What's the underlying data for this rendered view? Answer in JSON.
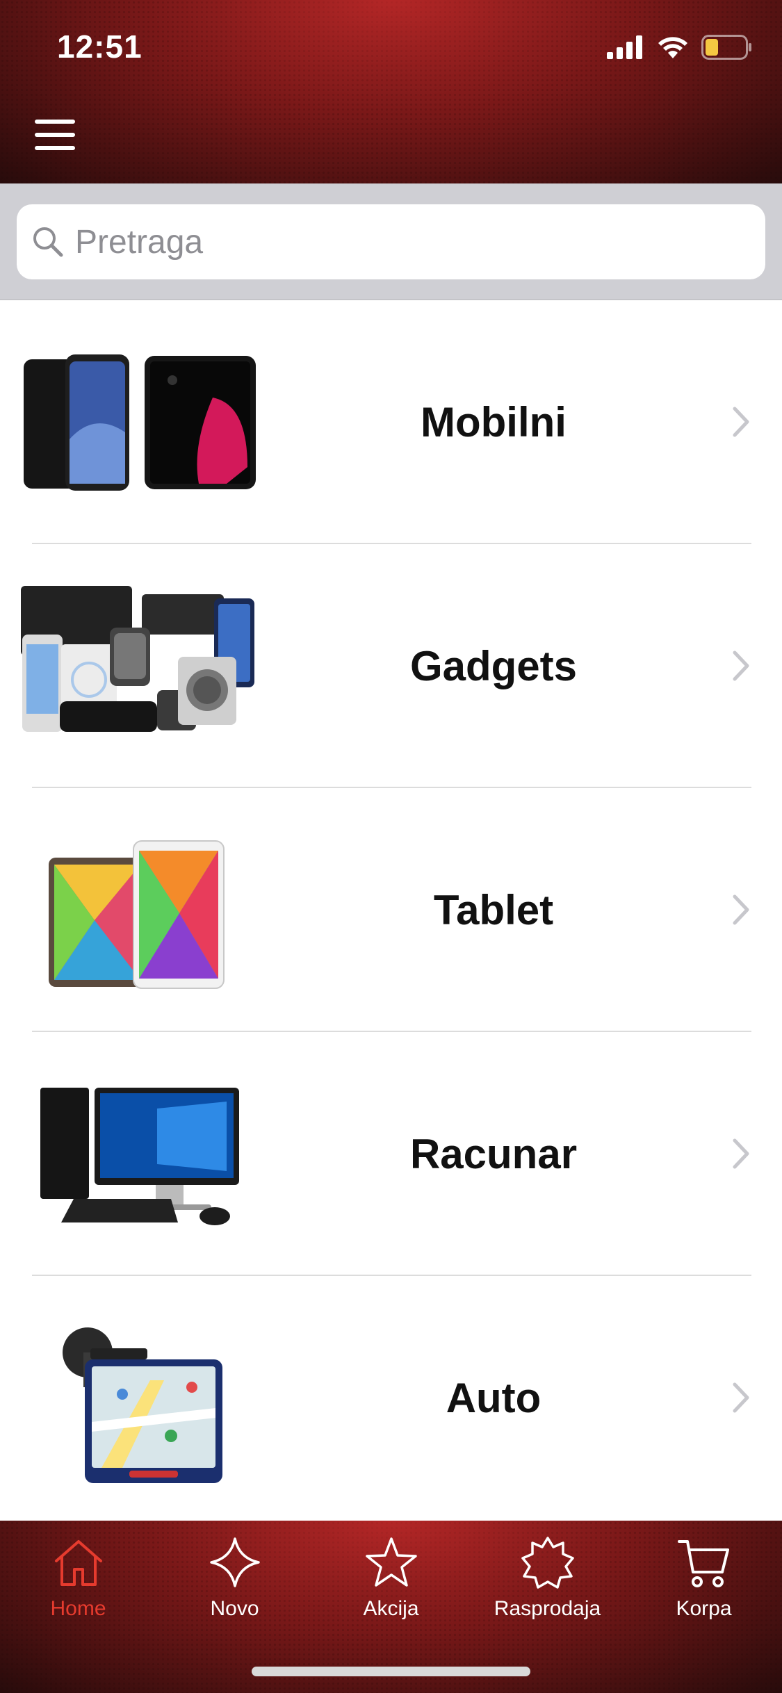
{
  "status_bar": {
    "time": "12:51"
  },
  "search": {
    "placeholder": "Pretraga"
  },
  "categories": [
    {
      "label": "Mobilni"
    },
    {
      "label": "Gadgets"
    },
    {
      "label": "Tablet"
    },
    {
      "label": "Racunar"
    },
    {
      "label": "Auto"
    }
  ],
  "tabs": [
    {
      "label": "Home",
      "icon": "home-icon",
      "active": true
    },
    {
      "label": "Novo",
      "icon": "sparkle-icon"
    },
    {
      "label": "Akcija",
      "icon": "star-icon"
    },
    {
      "label": "Rasprodaja",
      "icon": "badge-icon"
    },
    {
      "label": "Korpa",
      "icon": "cart-icon"
    }
  ],
  "colors": {
    "header_red": "#8b1d1d",
    "active_tab": "#e63b2e",
    "search_bg": "#cfcfd4",
    "battery_fill": "#f5c842"
  }
}
